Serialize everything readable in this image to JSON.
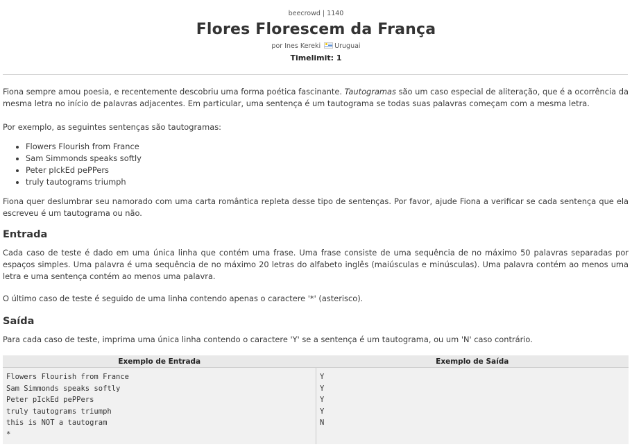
{
  "header": {
    "source": "beecrowd | 1140",
    "title": "Flores Florescem da França",
    "author_prefix": "por Ines Kereki",
    "country": "Uruguai",
    "timelimit": "Timelimit: 1"
  },
  "statement": {
    "p1_before": "Fiona sempre amou poesia, e recentemente descobriu uma forma poética fascinante. ",
    "p1_italic": "Tautogramas",
    "p1_after": " são um caso especial de aliteração, que é a ocorrência da mesma letra no início de palavras adjacentes. Em particular, uma sentença é um tautograma se todas suas palavras começam com a mesma letra.",
    "p2": "Por exemplo, as seguintes sentenças são tautogramas:",
    "examples": [
      "Flowers Flourish from France",
      "Sam Simmonds speaks softly",
      "Peter pIckEd pePPers",
      "truly tautograms triumph"
    ],
    "p3": "Fiona quer deslumbrar seu namorado com uma carta romântica repleta desse tipo de sentenças. Por favor, ajude Fiona a verificar se cada sentença que ela escreveu é um tautograma ou não."
  },
  "input_section": {
    "title": "Entrada",
    "p1": "Cada caso de teste é dado em uma única linha que contém uma frase. Uma frase consiste de uma sequência de no máximo 50 palavras separadas por espaços simples. Uma palavra é uma sequência de no máximo 20 letras do alfabeto inglês (maiúsculas e minúsculas). Uma palavra contém ao menos uma letra e uma sentença contém ao menos uma palavra.",
    "p2": "O último caso de teste é seguido de uma linha contendo apenas o caractere '*' (asterisco)."
  },
  "output_section": {
    "title": "Saída",
    "p1": "Para cada caso de teste, imprima uma única linha contendo o caractere 'Y' se a sentença é um tautograma, ou um 'N' caso contrário."
  },
  "samples": {
    "input_header": "Exemplo de Entrada",
    "output_header": "Exemplo de Saída",
    "input_lines": [
      "Flowers Flourish from France",
      "Sam Simmonds speaks softly",
      "Peter pIckEd pePPers",
      "truly tautograms triumph",
      "this is NOT a tautogram",
      "*"
    ],
    "output_lines": [
      "Y",
      "Y",
      "Y",
      "Y",
      "N"
    ]
  }
}
